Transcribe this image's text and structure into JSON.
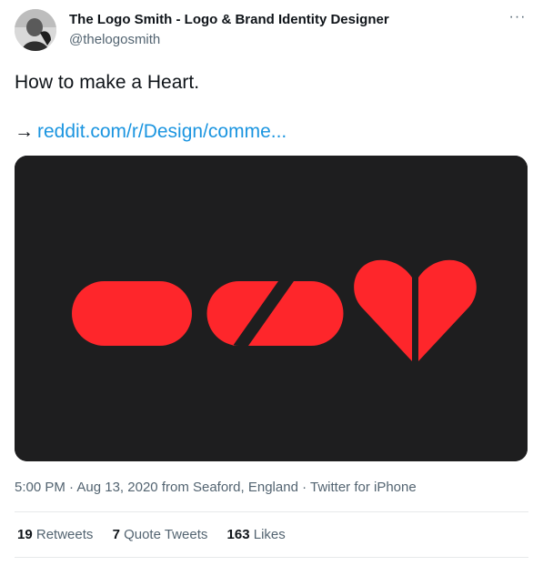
{
  "author": {
    "name": "The Logo Smith - Logo & Brand Identity Designer",
    "handle": "@thelogosmith"
  },
  "more_label": "···",
  "tweet": {
    "text": "How to make a Heart.",
    "arrow": "→",
    "link_text": "reddit.com/r/Design/comme..."
  },
  "meta": {
    "time": "5:00 PM",
    "separator": "·",
    "date": "Aug 13, 2020",
    "from": "from",
    "location": "Seaford, England",
    "source": "Twitter for iPhone"
  },
  "stats": {
    "retweets_count": "19",
    "retweets_label": "Retweets",
    "quotes_count": "7",
    "quotes_label": "Quote Tweets",
    "likes_count": "163",
    "likes_label": "Likes"
  },
  "icons": {
    "more": "more-icon",
    "avatar": "avatar-image"
  },
  "colors": {
    "shape_red": "#fe262b",
    "media_bg": "#1e1e1f",
    "link": "#1b95e0",
    "secondary_text": "#536471"
  }
}
